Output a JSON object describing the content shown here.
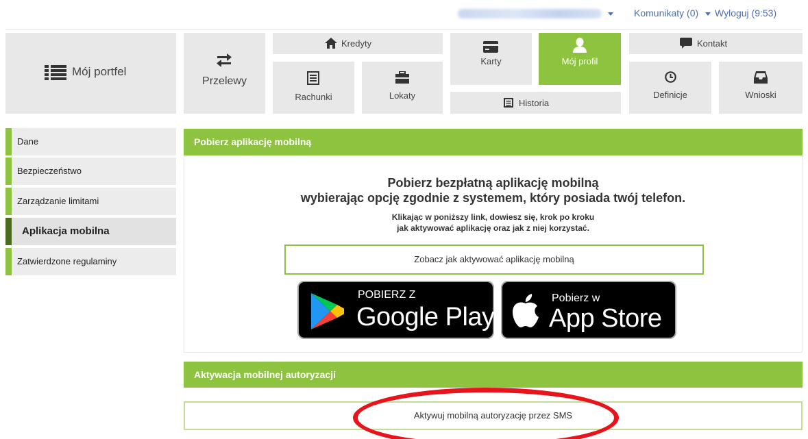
{
  "topbar": {
    "messages_label": "Komunikaty (0)",
    "logout_label": "Wyloguj (9:53)"
  },
  "nav": {
    "portfolio": "Mój portfel",
    "transfers": "Przelewy",
    "credits": "Kredyty",
    "accounts": "Rachunki",
    "deposits": "Lokaty",
    "cards": "Karty",
    "profile": "Mój profil",
    "history": "Historia",
    "contact": "Kontakt",
    "definitions": "Definicje",
    "applications": "Wnioski"
  },
  "sidebar": {
    "items": [
      {
        "label": "Dane"
      },
      {
        "label": "Bezpieczeństwo"
      },
      {
        "label": "Zarządzanie limitami"
      },
      {
        "label": "Aplikacja mobilna"
      },
      {
        "label": "Zatwierdzone regulaminy"
      }
    ]
  },
  "mobile_app": {
    "header": "Pobierz aplikację mobilną",
    "title_line1": "Pobierz bezpłatną aplikację mobilną",
    "title_line2": "wybierając opcję zgodnie z systemem, który posiada twój telefon.",
    "sub_line1": "Klikając w poniższy link, dowiesz się, krok po kroku",
    "sub_line2": "jak aktywować aplikację oraz jak z niej korzystać.",
    "link_label": "Zobacz jak aktywować aplikację mobilną",
    "google_small": "POBIERZ Z",
    "google_big": "Google Play",
    "apple_small": "Pobierz w",
    "apple_big": "App Store"
  },
  "mobile_auth": {
    "header": "Aktywacja mobilnej autoryzacji",
    "sms_button": "Aktywuj mobilną autoryzację przez SMS"
  },
  "colors": {
    "accent_green": "#8dc33e",
    "active_border": "#4a6a1f",
    "link_blue": "#4a6fb5",
    "highlight_red": "#e8141b"
  }
}
